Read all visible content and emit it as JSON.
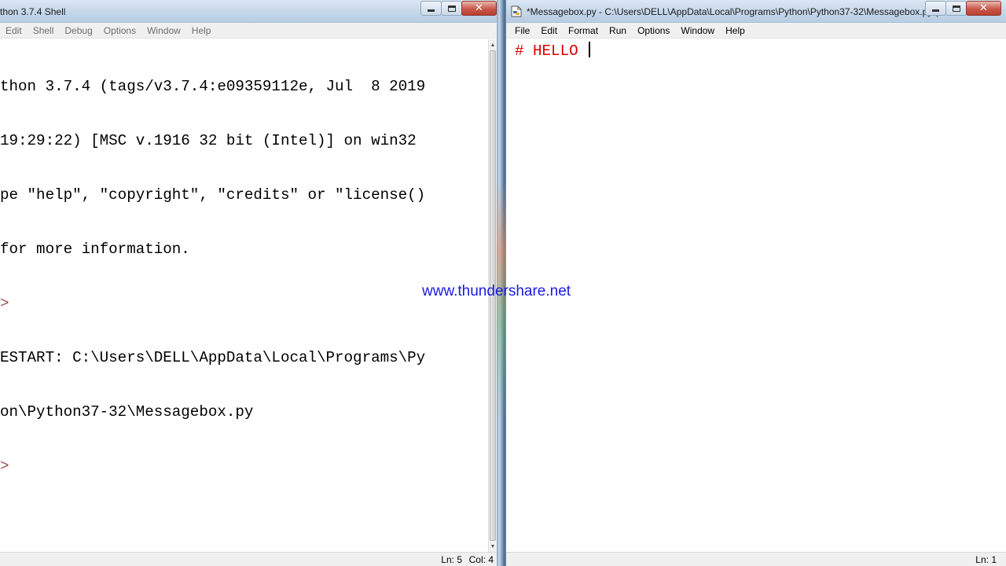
{
  "shell": {
    "title": "thon 3.7.4 Shell",
    "menu": [
      "Edit",
      "Shell",
      "Debug",
      "Options",
      "Window",
      "Help"
    ],
    "lines": [
      "thon 3.7.4 (tags/v3.7.4:e09359112e, Jul  8 2019",
      "19:29:22) [MSC v.1916 32 bit (Intel)] on win32",
      "pe \"help\", \"copyright\", \"credits\" or \"license()",
      "for more information.",
      ">",
      "ESTART: C:\\Users\\DELL\\AppData\\Local\\Programs\\Py",
      "on\\Python37-32\\Messagebox.py",
      ">"
    ],
    "status": {
      "ln": "Ln: 5",
      "col": "Col: 4"
    }
  },
  "editor": {
    "title": "*Messagebox.py - C:\\Users\\DELL\\AppData\\Local\\Programs\\Python\\Python37-32\\Messagebox.py (3....",
    "menu": [
      "File",
      "Edit",
      "Format",
      "Run",
      "Options",
      "Window",
      "Help"
    ],
    "code_line": "# HELLO ",
    "status": {
      "ln": "Ln: 1"
    }
  },
  "watermark": "www.thundershare.net",
  "colors": {
    "comment": "#dd0000",
    "prompt": "#a05050",
    "watermark": "#1a1ae0"
  },
  "icons": [
    "minimize-icon",
    "maximize-icon",
    "close-icon",
    "python-file-icon"
  ]
}
